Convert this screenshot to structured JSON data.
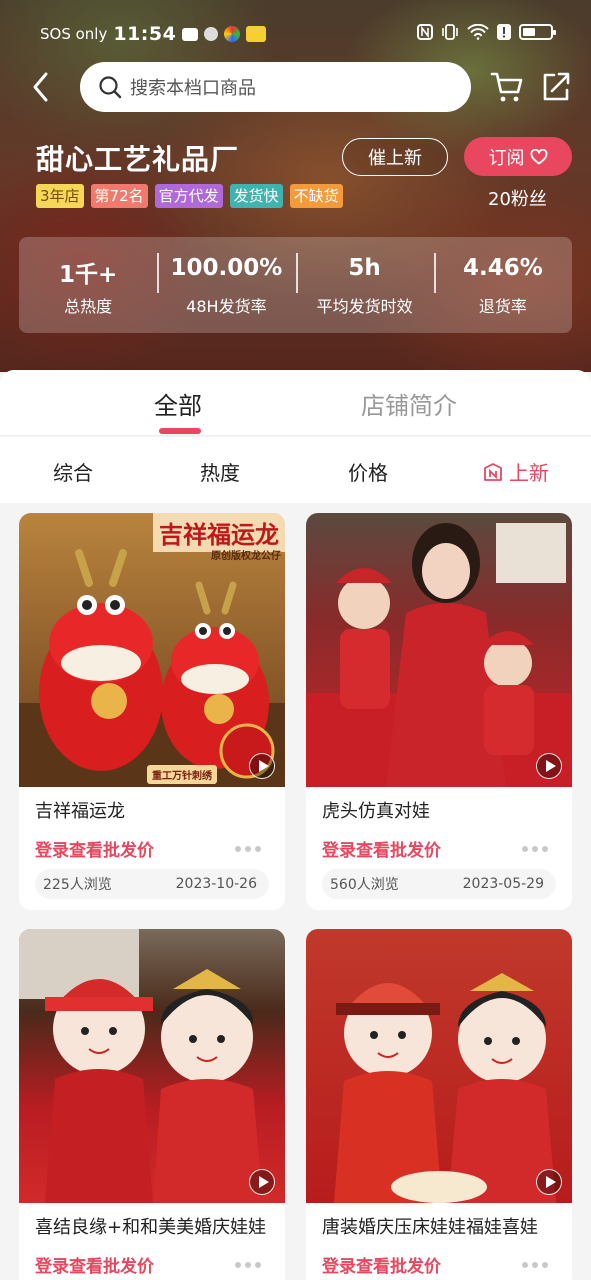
{
  "status_bar": {
    "carrier": "SOS only",
    "time": "11:54"
  },
  "search": {
    "placeholder": "搜索本档口商品"
  },
  "shop": {
    "name": "甜心工艺礼品厂",
    "tags": [
      "3年店",
      "第72名",
      "官方代发",
      "发货快",
      "不缺货"
    ],
    "urge_label": "催上新",
    "subscribe_label": "订阅",
    "fans": "20粉丝"
  },
  "stats": [
    {
      "value": "1千+",
      "label": "总热度"
    },
    {
      "value": "100.00%",
      "label": "48H发货率"
    },
    {
      "value": "5h",
      "label": "平均发货时效"
    },
    {
      "value": "4.46%",
      "label": "退货率"
    }
  ],
  "tabs": {
    "all": "全部",
    "intro": "店铺简介"
  },
  "sort": {
    "comprehensive": "综合",
    "popularity": "热度",
    "price": "价格",
    "new": "上新"
  },
  "colors": {
    "accent": "#e8475f"
  },
  "products": [
    {
      "title": "吉祥福运龙",
      "price_label": "登录查看批发价",
      "views": "225人浏览",
      "date": "2023-10-26",
      "banner": "吉祥福运龙",
      "banner_sub": "原创版权龙公仔",
      "badge": "重工万针刺绣"
    },
    {
      "title": "虎头仿真对娃",
      "price_label": "登录查看批发价",
      "views": "560人浏览",
      "date": "2023-05-29"
    },
    {
      "title": "喜结良缘+和和美美婚庆娃娃",
      "price_label": "登录查看批发价"
    },
    {
      "title": "唐装婚庆压床娃娃福娃喜娃",
      "price_label": "登录查看批发价"
    }
  ]
}
